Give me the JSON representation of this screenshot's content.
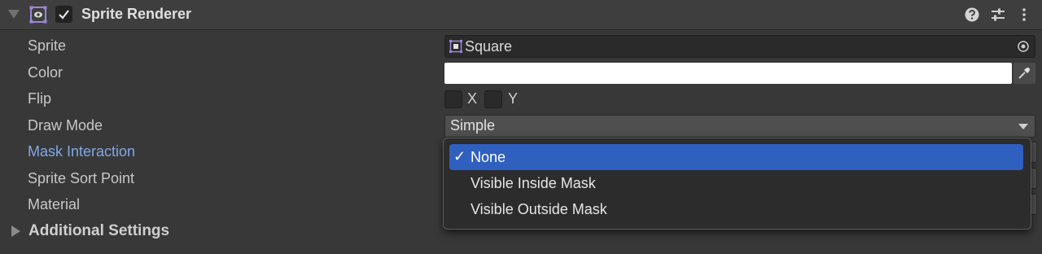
{
  "header": {
    "title": "Sprite Renderer",
    "enabled": true,
    "help_icon": "help-icon",
    "presets_icon": "presets-icon",
    "menu_icon": "kebab-menu-icon"
  },
  "fields": {
    "sprite_label": "Sprite",
    "sprite_value": "Square",
    "color_label": "Color",
    "color_value": "#FFFFFF",
    "flip_label": "Flip",
    "flip_x_label": "X",
    "flip_y_label": "Y",
    "draw_mode_label": "Draw Mode",
    "draw_mode_value": "Simple",
    "mask_interaction_label": "Mask Interaction",
    "sprite_sort_point_label": "Sprite Sort Point",
    "material_label": "Material",
    "additional_settings_label": "Additional Settings"
  },
  "mask_dropdown": {
    "options": [
      {
        "label": "None",
        "selected": true,
        "check": "✓"
      },
      {
        "label": "Visible Inside Mask",
        "selected": false
      },
      {
        "label": "Visible Outside Mask",
        "selected": false
      }
    ]
  },
  "colors": {
    "accent": "#2f5fbf",
    "highlight_label": "#7fa9e8",
    "background": "#383838"
  }
}
